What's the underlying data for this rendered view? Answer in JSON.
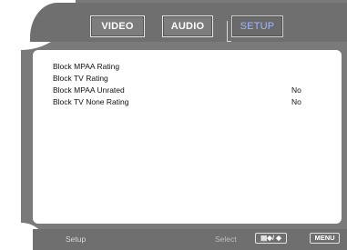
{
  "tabs": [
    {
      "label": "VIDEO",
      "active": false
    },
    {
      "label": "AUDIO",
      "active": false
    },
    {
      "label": "SETUP",
      "active": true
    }
  ],
  "settings": {
    "rows": [
      {
        "label": "Block MPAA Rating",
        "value": ""
      },
      {
        "label": "Block TV Rating",
        "value": ""
      },
      {
        "label": "Block MPAA Unrated",
        "value": "No"
      },
      {
        "label": "Block TV None Rating",
        "value": "No"
      }
    ]
  },
  "footer": {
    "section": "Setup",
    "hint": "Select",
    "nav_key": "▤◆/ ◆",
    "menu_key": "MENU"
  },
  "colors": {
    "frame": "#7a7a7a",
    "bar": "#6f6f6f",
    "active_tab_text": "#9fb8ff",
    "panel": "#ffffff"
  }
}
